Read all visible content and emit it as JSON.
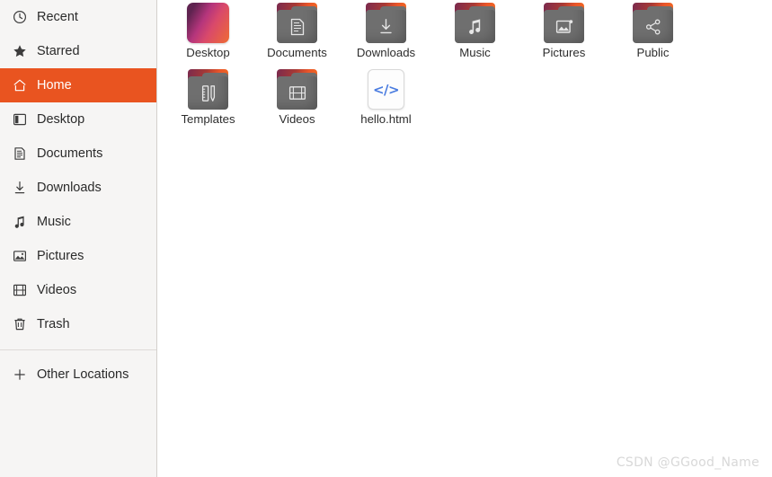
{
  "colors": {
    "accent": "#e95420",
    "sidebar_bg": "#f6f5f4",
    "main_bg": "#ffffff",
    "folder_grey": "#6f6f6f",
    "html_blue": "#4a7ce0",
    "watermark_grey": "#d8d8d8"
  },
  "sidebar": {
    "items": [
      {
        "label": "Recent",
        "icon": "clock-icon",
        "active": false
      },
      {
        "label": "Starred",
        "icon": "star-icon",
        "active": false
      },
      {
        "label": "Home",
        "icon": "home-icon",
        "active": true
      },
      {
        "label": "Desktop",
        "icon": "desktop-icon",
        "active": false
      },
      {
        "label": "Documents",
        "icon": "document-icon",
        "active": false
      },
      {
        "label": "Downloads",
        "icon": "download-icon",
        "active": false
      },
      {
        "label": "Music",
        "icon": "music-note-icon",
        "active": false
      },
      {
        "label": "Pictures",
        "icon": "picture-icon",
        "active": false
      },
      {
        "label": "Videos",
        "icon": "film-icon",
        "active": false
      },
      {
        "label": "Trash",
        "icon": "trash-icon",
        "active": false
      }
    ],
    "other_locations": {
      "label": "Other Locations",
      "icon": "plus-icon"
    }
  },
  "files": [
    {
      "name": "Desktop",
      "kind": "wallpaper",
      "emblem": "wallpaper-icon"
    },
    {
      "name": "Documents",
      "kind": "folder",
      "emblem": "document-icon"
    },
    {
      "name": "Downloads",
      "kind": "folder",
      "emblem": "download-icon"
    },
    {
      "name": "Music",
      "kind": "folder",
      "emblem": "music-note-icon"
    },
    {
      "name": "Pictures",
      "kind": "folder",
      "emblem": "picture-icon"
    },
    {
      "name": "Public",
      "kind": "folder",
      "emblem": "share-icon"
    },
    {
      "name": "Templates",
      "kind": "folder",
      "emblem": "template-icon"
    },
    {
      "name": "Videos",
      "kind": "folder",
      "emblem": "film-icon"
    },
    {
      "name": "hello.html",
      "kind": "file",
      "emblem": "code-icon",
      "glyph": "</>"
    }
  ],
  "watermark": {
    "text": "CSDN @GGood_Name"
  }
}
